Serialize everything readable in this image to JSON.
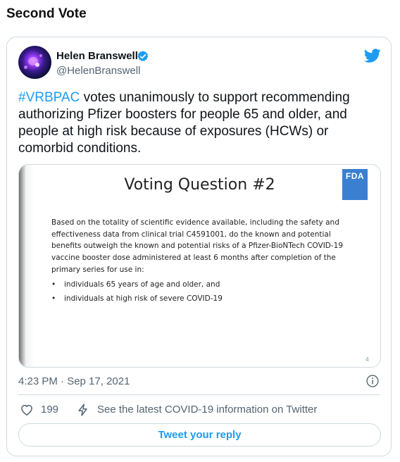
{
  "section": {
    "title": "Second Vote"
  },
  "tweet": {
    "author_name": "Helen Branswell",
    "author_handle": "@HelenBranswell",
    "hashtag": "#VRBPAC",
    "text": " votes unanimously to support recommending authorizing Pfizer boosters for people 65 and older, and people at high risk because of exposures (HCWs) or comorbid conditions.",
    "timestamp": "4:23 PM · Sep 17, 2021",
    "like_count": "199",
    "covid_link": "See the latest COVID-19 information on Twitter",
    "reply_label": "Tweet your reply",
    "icons": {
      "verified": "verified-badge-icon",
      "brand": "twitter-bird-icon",
      "info": "info-icon",
      "like": "heart-icon",
      "covid": "lightning-icon"
    },
    "colors": {
      "accent": "#1d9bf0",
      "secondary_text": "#536471",
      "border": "#cfd9de"
    }
  },
  "slide": {
    "title": "Voting Question #2",
    "logo_text": "FDA",
    "body": "Based on the totality of scientific evidence available, including the safety and effectiveness data from clinical trial C4591001, do the known and potential benefits outweigh the known and potential risks of a Pfizer-BioNTech COVID-19 vaccine booster dose administered at least 6 months after completion of the primary series for use in:",
    "bullets": [
      "individuals 65 years of age and older, and",
      "individuals at high risk of severe COVID-19"
    ],
    "page_number": "4"
  }
}
